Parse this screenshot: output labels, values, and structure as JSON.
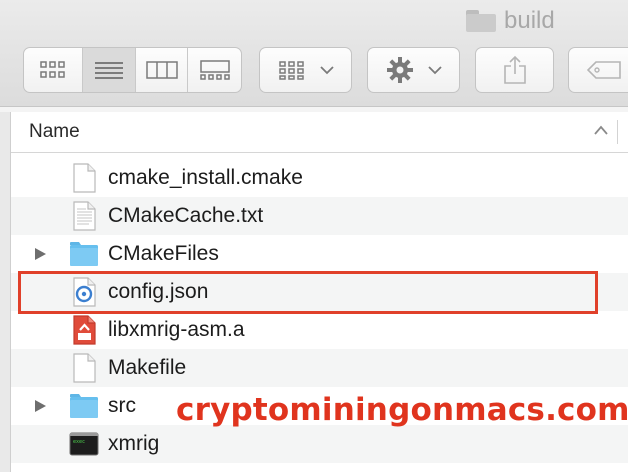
{
  "window": {
    "title": "build"
  },
  "toolbar": {
    "view_modes": [
      {
        "name": "icon-view-icon",
        "active": false
      },
      {
        "name": "list-view-icon",
        "active": true
      },
      {
        "name": "column-view-icon",
        "active": false
      },
      {
        "name": "gallery-view-icon",
        "active": false
      }
    ],
    "group_menu_icon": "group-grid-icon",
    "action_menu_icon": "gear-icon",
    "share_icon": "share-icon",
    "tag_icon": "tag-icon"
  },
  "header": {
    "name_label": "Name",
    "sort": "ascending"
  },
  "files": [
    {
      "name": "cmake_install.cmake",
      "kind": "document",
      "expandable": false
    },
    {
      "name": "CMakeCache.txt",
      "kind": "text-document",
      "expandable": false
    },
    {
      "name": "CMakeFiles",
      "kind": "folder",
      "expandable": true
    },
    {
      "name": "config.json",
      "kind": "json-document",
      "expandable": false,
      "highlighted": true
    },
    {
      "name": "libxmrig-asm.a",
      "kind": "archive",
      "expandable": false
    },
    {
      "name": "Makefile",
      "kind": "document",
      "expandable": false
    },
    {
      "name": "src",
      "kind": "folder",
      "expandable": true
    },
    {
      "name": "xmrig",
      "kind": "executable",
      "expandable": false
    }
  ],
  "watermark": "cryptominingonmacs.com",
  "colors": {
    "highlight": "#e0402a",
    "folder": "#66bfee",
    "watermark": "#e0341e"
  }
}
